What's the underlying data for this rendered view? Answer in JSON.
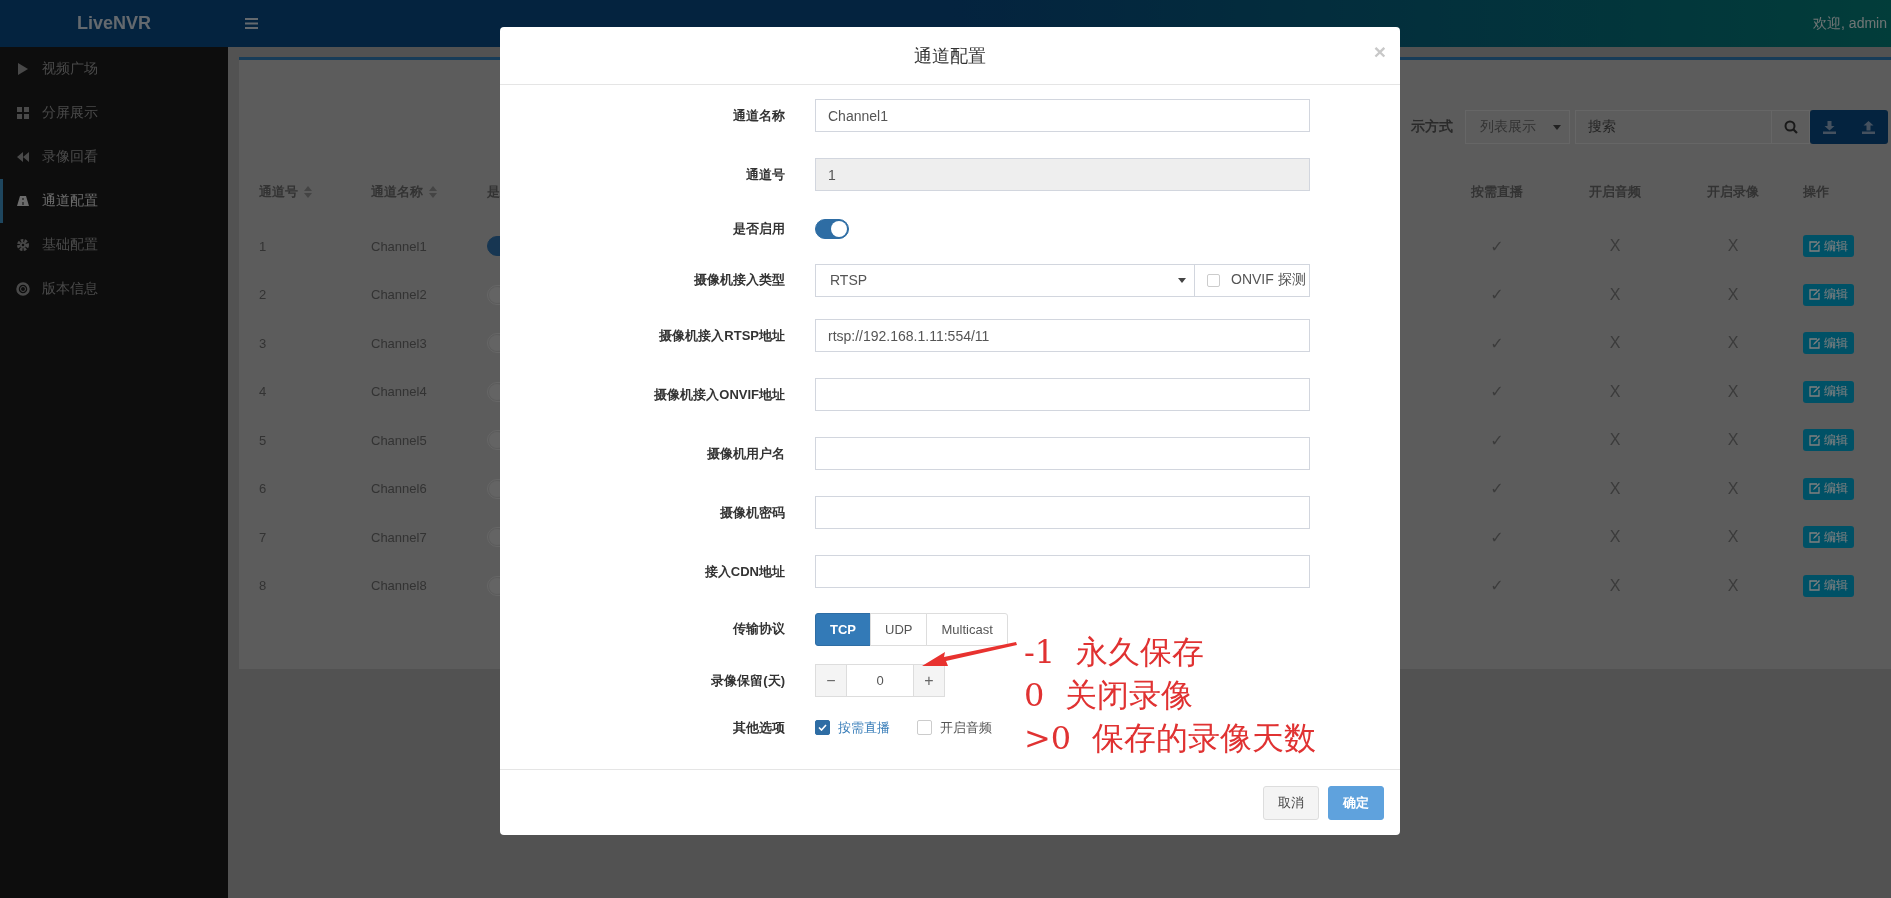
{
  "header": {
    "logo": "LiveNVR",
    "greeting": "欢迎, admin"
  },
  "sidebar": {
    "items": [
      {
        "label": "视频广场",
        "selected": false
      },
      {
        "label": "分屏展示",
        "selected": false
      },
      {
        "label": "录像回看",
        "selected": false
      },
      {
        "label": "通道配置",
        "selected": true
      },
      {
        "label": "基础配置",
        "selected": false
      },
      {
        "label": "版本信息",
        "selected": false
      }
    ]
  },
  "toolbar": {
    "display_label": "示方式",
    "display_select": "列表展示",
    "search": {
      "placeholder": "搜索"
    }
  },
  "table": {
    "columns_left": [
      {
        "label": "通道号",
        "sortable": true
      },
      {
        "label": "通道名称",
        "sortable": true
      },
      {
        "label": "是",
        "sortable": false
      }
    ],
    "columns_right": [
      {
        "label": "按需直播"
      },
      {
        "label": "开启音频"
      },
      {
        "label": "开启录像"
      },
      {
        "label": "操作"
      }
    ],
    "rows": [
      {
        "number": "1",
        "name": "Channel1",
        "enabled": true,
        "on_demand": "✓",
        "audio": "X",
        "record": "X",
        "action": "编辑"
      },
      {
        "number": "2",
        "name": "Channel2",
        "enabled": false,
        "on_demand": "✓",
        "audio": "X",
        "record": "X",
        "action": "编辑"
      },
      {
        "number": "3",
        "name": "Channel3",
        "enabled": false,
        "on_demand": "✓",
        "audio": "X",
        "record": "X",
        "action": "编辑"
      },
      {
        "number": "4",
        "name": "Channel4",
        "enabled": false,
        "on_demand": "✓",
        "audio": "X",
        "record": "X",
        "action": "编辑"
      },
      {
        "number": "5",
        "name": "Channel5",
        "enabled": false,
        "on_demand": "✓",
        "audio": "X",
        "record": "X",
        "action": "编辑"
      },
      {
        "number": "6",
        "name": "Channel6",
        "enabled": false,
        "on_demand": "✓",
        "audio": "X",
        "record": "X",
        "action": "编辑"
      },
      {
        "number": "7",
        "name": "Channel7",
        "enabled": false,
        "on_demand": "✓",
        "audio": "X",
        "record": "X",
        "action": "编辑"
      },
      {
        "number": "8",
        "name": "Channel8",
        "enabled": false,
        "on_demand": "✓",
        "audio": "X",
        "record": "X",
        "action": "编辑"
      }
    ]
  },
  "modal": {
    "title": "通道配置",
    "close": "×",
    "fields": [
      {
        "kind": "text",
        "label": "通道名称",
        "value": "Channel1",
        "disabled": false
      },
      {
        "kind": "text",
        "label": "通道号",
        "value": "1",
        "disabled": true
      },
      {
        "kind": "switch",
        "label": "是否启用",
        "on": true
      },
      {
        "kind": "select",
        "label": "摄像机接入类型",
        "value": "RTSP",
        "checkbox": {
          "label": "ONVIF 探测",
          "checked": false
        }
      },
      {
        "kind": "text",
        "label": "摄像机接入RTSP地址",
        "value": "rtsp://192.168.1.11:554/11",
        "disabled": false
      },
      {
        "kind": "text",
        "label": "摄像机接入ONVIF地址",
        "disabled": false
      },
      {
        "kind": "text",
        "label": "摄像机用户名",
        "disabled": false
      },
      {
        "kind": "text",
        "label": "摄像机密码",
        "disabled": false
      },
      {
        "kind": "text",
        "label": "接入CDN地址",
        "disabled": false
      },
      {
        "kind": "segmented",
        "label": "传输协议",
        "options": [
          {
            "label": "TCP",
            "selected": true
          },
          {
            "label": "UDP",
            "selected": false
          },
          {
            "label": "Multicast",
            "selected": false
          }
        ]
      },
      {
        "kind": "stepper",
        "label": "录像保留(天)",
        "minus": "−",
        "value": "0",
        "plus": "+"
      },
      {
        "kind": "checkboxes",
        "label": "其他选项",
        "options": [
          {
            "label": "按需直播",
            "checked": true
          },
          {
            "label": "开启音频",
            "checked": false
          }
        ]
      }
    ],
    "buttons": [
      {
        "label": "取消",
        "kind": "default"
      },
      {
        "label": "确定",
        "kind": "primary"
      }
    ],
    "annotation": {
      "lines": [
        "-1  永久保存",
        "0  关闭录像",
        ">0  保存的录像天数"
      ]
    }
  }
}
